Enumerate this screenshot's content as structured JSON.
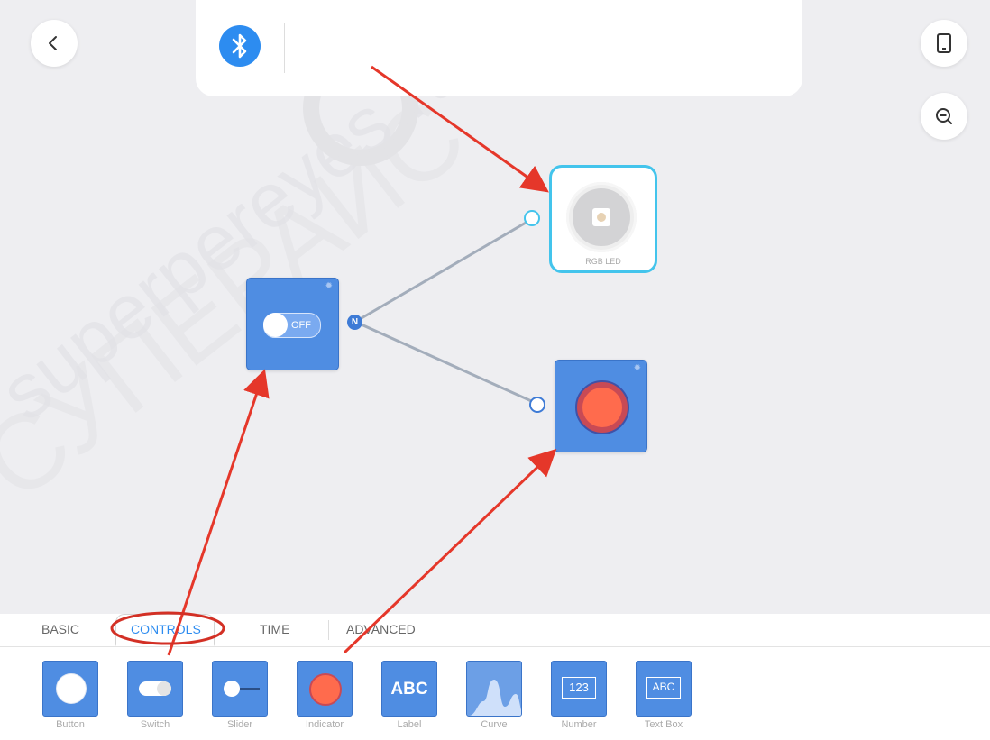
{
  "header": {
    "back_icon": "chevron-left-icon",
    "bluetooth_icon": "bluetooth-icon",
    "device_icon": "tablet-icon",
    "zoom_out_icon": "zoom-out-icon"
  },
  "watermark": {
    "line1": "superpereyes.ru",
    "line2": "СУПЕРАИС"
  },
  "canvas": {
    "rgb_node": {
      "label": "RGB LED",
      "color": "#e7d2b4"
    },
    "switch_node": {
      "state_label": "OFF"
    },
    "indicator_node": {
      "color": "#ff6b4d"
    },
    "port_label": "N"
  },
  "palette": {
    "tabs": [
      {
        "label": "BASIC"
      },
      {
        "label": "CONTROLS",
        "active": true
      },
      {
        "label": "TIME"
      },
      {
        "label": "ADVANCED"
      }
    ],
    "items": [
      {
        "label": "Button"
      },
      {
        "label": "Switch"
      },
      {
        "label": "Slider"
      },
      {
        "label": "Indicator"
      },
      {
        "label": "Label",
        "glyph": "ABC"
      },
      {
        "label": "Curve"
      },
      {
        "label": "Number",
        "glyph": "123"
      },
      {
        "label": "Text Box",
        "glyph": "ABC"
      }
    ]
  },
  "colors": {
    "accent": "#2d8cf0",
    "widget": "#4f8de2",
    "annotation": "#e5372a",
    "port": "#43c4ec"
  }
}
